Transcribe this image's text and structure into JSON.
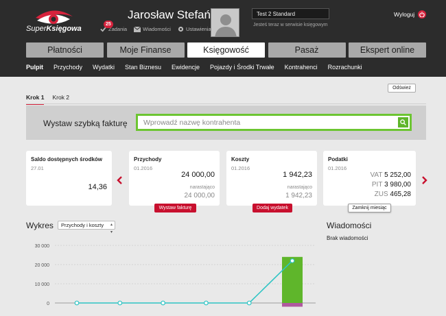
{
  "header": {
    "logo": {
      "prefix": "Super",
      "suffix": "Księgowa"
    },
    "username": "Jarosław Stefański",
    "links": [
      {
        "label": "Zadania",
        "badge": "25",
        "icon": "tasks-icon"
      },
      {
        "label": "Wiadomości",
        "icon": "mail-icon"
      },
      {
        "label": "Ustawienia",
        "icon": "gear-icon"
      }
    ],
    "account": {
      "name": "Test 2 Standard",
      "note": "Jesteś teraz w serwisie księgowym"
    },
    "logout_label": "Wyloguj"
  },
  "main_nav": [
    {
      "label": "Płatności",
      "active": false
    },
    {
      "label": "Moje Finanse",
      "active": false
    },
    {
      "label": "Księgowość",
      "active": true
    },
    {
      "label": "Pasaż",
      "active": false
    },
    {
      "label": "Ekspert online",
      "active": false
    }
  ],
  "sub_nav": [
    {
      "label": "Pulpit",
      "active": true
    },
    {
      "label": "Przychody"
    },
    {
      "label": "Wydatki"
    },
    {
      "label": "Stan Biznesu"
    },
    {
      "label": "Ewidencje"
    },
    {
      "label": "Pojazdy i Środki Trwałe"
    },
    {
      "label": "Kontrahenci"
    },
    {
      "label": "Rozrachunki"
    }
  ],
  "refresh_label": "Odśwież",
  "steps": [
    {
      "label": "Krok 1",
      "active": true
    },
    {
      "label": "Krok 2",
      "active": false
    }
  ],
  "quick_invoice": {
    "label": "Wystaw szybką fakturę",
    "placeholder": "Wprowadź nazwę kontrahenta"
  },
  "cards": {
    "saldo": {
      "title": "Saldo dostępnych środków",
      "date": "27.01",
      "amount": "14,36"
    },
    "przychody": {
      "title": "Przychody",
      "date": "01.2016",
      "amount": "24 000,00",
      "sub_label": "narastająco",
      "sub_amount": "24 000,00",
      "button": "Wystaw fakturę"
    },
    "koszty": {
      "title": "Koszty",
      "date": "01.2016",
      "amount": "1 942,23",
      "sub_label": "narastająco",
      "sub_amount": "1 942,23",
      "button": "Dodaj wydatek"
    },
    "podatki": {
      "title": "Podatki",
      "date": "01.2016",
      "lines": [
        {
          "label": "VAT",
          "value": "5 252,00"
        },
        {
          "label": "PIT",
          "value": "3 980,00"
        },
        {
          "label": "ZUS",
          "value": "465,28"
        }
      ],
      "button": "Zamknij miesiąc"
    }
  },
  "chart_section": {
    "title": "Wykres",
    "select_value": "Przychody i koszty"
  },
  "messages": {
    "title": "Wiadomości",
    "empty": "Brak wiadomości"
  },
  "colors": {
    "accent": "#d6223c",
    "green": "#6cc531",
    "line": "#2ec4c4",
    "bar": "#5fb62b",
    "bar_neg": "#b0589f"
  },
  "chart_data": {
    "type": "line",
    "yticks": [
      "30 000",
      "20 000",
      "10 000",
      "0"
    ],
    "ylim": [
      0,
      30000
    ],
    "series": [
      {
        "type": "line",
        "values": [
          0,
          0,
          0,
          0,
          0,
          22000
        ]
      },
      {
        "type": "bar",
        "values": [
          0,
          0,
          0,
          0,
          0,
          24000
        ]
      },
      {
        "type": "bar",
        "values": [
          0,
          0,
          0,
          0,
          0,
          -1942.23
        ]
      }
    ]
  }
}
